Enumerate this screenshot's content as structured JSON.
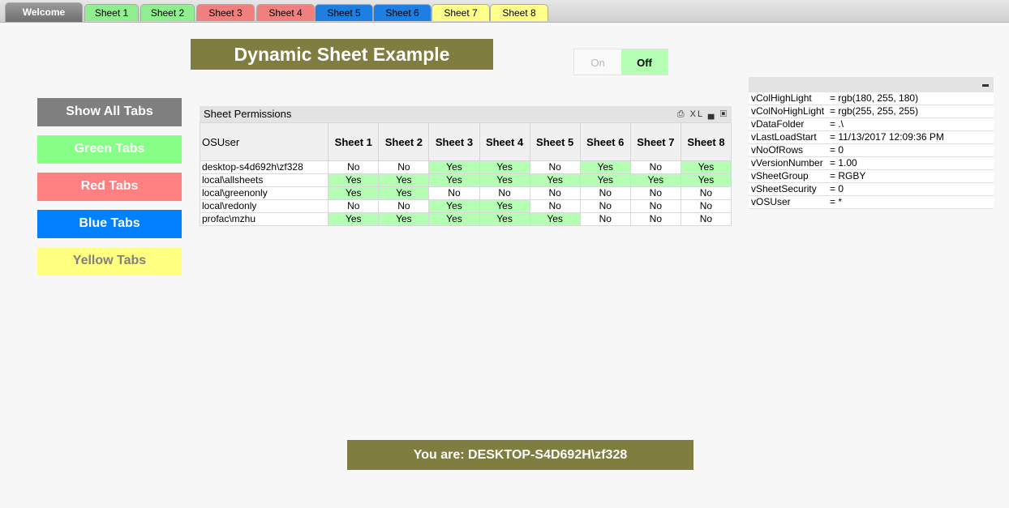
{
  "tabs": [
    {
      "label": "Welcome",
      "bg": "#7f7f7f",
      "color": "#ffffff"
    },
    {
      "label": "Sheet 1",
      "bg": "#90ee90",
      "color": "#000000"
    },
    {
      "label": "Sheet 2",
      "bg": "#90ee90",
      "color": "#000000"
    },
    {
      "label": "Sheet 3",
      "bg": "#f08080",
      "color": "#000000"
    },
    {
      "label": "Sheet 4",
      "bg": "#f08080",
      "color": "#000000"
    },
    {
      "label": "Sheet 5",
      "bg": "#1e7fe0",
      "color": "#000000"
    },
    {
      "label": "Sheet 6",
      "bg": "#1e7fe0",
      "color": "#000000"
    },
    {
      "label": "Sheet 7",
      "bg": "#ffff8c",
      "color": "#000000"
    },
    {
      "label": "Sheet 8",
      "bg": "#ffff8c",
      "color": "#000000"
    }
  ],
  "title": "Dynamic Sheet Example",
  "toggle": {
    "on_label": "On",
    "off_label": "Off"
  },
  "side_buttons": [
    {
      "label": "Show All Tabs",
      "bg": "#7f7f7f",
      "color": "#ffffff"
    },
    {
      "label": "Green Tabs",
      "bg": "#87ff87",
      "color": "#ffffff"
    },
    {
      "label": "Red Tabs",
      "bg": "#ff8080",
      "color": "#ffffff"
    },
    {
      "label": "Blue Tabs",
      "bg": "#0080ff",
      "color": "#ffffff"
    },
    {
      "label": "Yellow Tabs",
      "bg": "#ffff80",
      "color": "#808080"
    }
  ],
  "permissions": {
    "caption": "Sheet Permissions",
    "icons_text": "XL",
    "columns": [
      "OSUser",
      "Sheet 1",
      "Sheet 2",
      "Sheet 3",
      "Sheet 4",
      "Sheet 5",
      "Sheet 6",
      "Sheet 7",
      "Sheet 8"
    ],
    "rows": [
      {
        "user": "desktop-s4d692h\\zf328",
        "values": [
          "No",
          "No",
          "Yes",
          "Yes",
          "No",
          "Yes",
          "No",
          "Yes"
        ]
      },
      {
        "user": "local\\allsheets",
        "values": [
          "Yes",
          "Yes",
          "Yes",
          "Yes",
          "Yes",
          "Yes",
          "Yes",
          "Yes"
        ]
      },
      {
        "user": "local\\greenonly",
        "values": [
          "Yes",
          "Yes",
          "No",
          "No",
          "No",
          "No",
          "No",
          "No"
        ]
      },
      {
        "user": "local\\redonly",
        "values": [
          "No",
          "No",
          "Yes",
          "Yes",
          "No",
          "No",
          "No",
          "No"
        ]
      },
      {
        "user": "profac\\mzhu",
        "values": [
          "Yes",
          "Yes",
          "Yes",
          "Yes",
          "Yes",
          "No",
          "No",
          "No"
        ]
      }
    ]
  },
  "variables": [
    {
      "name": "vColHighLight",
      "value": "= rgb(180, 255, 180)"
    },
    {
      "name": "vColNoHighLight",
      "value": "= rgb(255, 255, 255)"
    },
    {
      "name": "vDataFolder",
      "value": "= .\\"
    },
    {
      "name": "vLastLoadStart",
      "value": "= 11/13/2017 12:09:36 PM"
    },
    {
      "name": "vNoOfRows",
      "value": "= 0"
    },
    {
      "name": "vVersionNumber",
      "value": "= 1.00"
    },
    {
      "name": "vSheetGroup",
      "value": "= RGBY"
    },
    {
      "name": "vSheetSecurity",
      "value": "= 0"
    },
    {
      "name": "vOSUser",
      "value": "= *"
    }
  ],
  "current_user_text": "You are: DESKTOP-S4D692H\\zf328",
  "colors": {
    "highlight": "#b4ffb4",
    "title_bg": "#7f7d3f"
  }
}
